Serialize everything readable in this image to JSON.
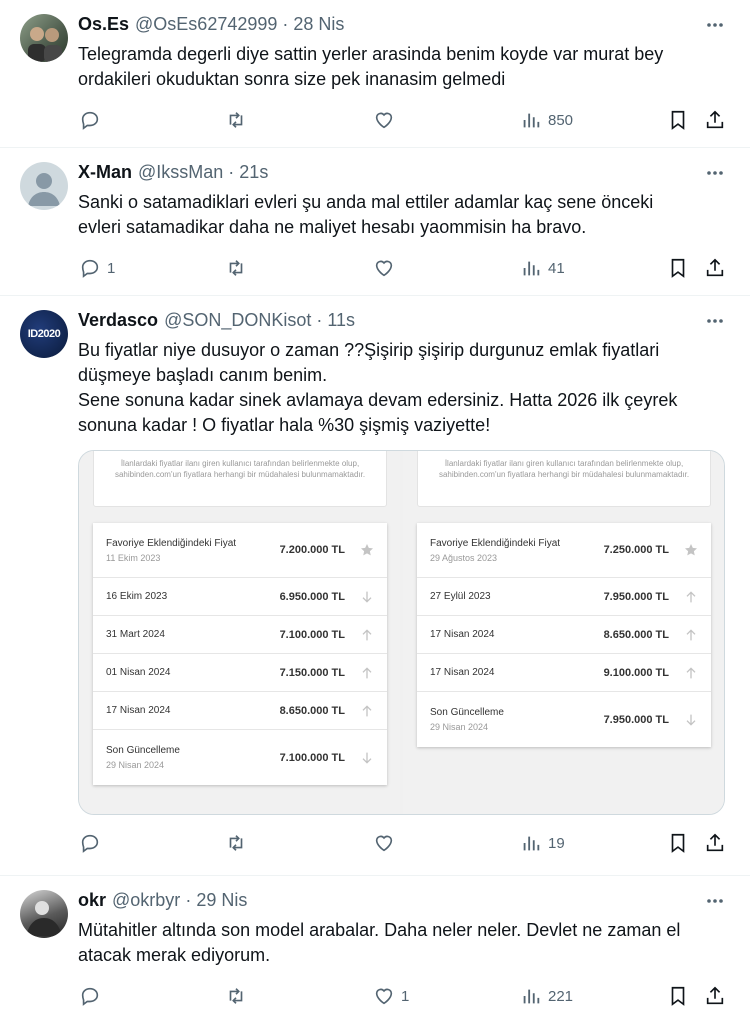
{
  "tweets": [
    {
      "name": "Os.Es",
      "handle": "@OsEs62742999",
      "time": "28 Nis",
      "text": "Telegramda degerli diye sattin yerler arasinda benim koyde var murat bey\nordakileri okuduktan sonra size pek inanasim gelmedi",
      "replies": "",
      "likes": "",
      "views": "850",
      "avatar_color": "#6b7d6a"
    },
    {
      "name": "X-Man",
      "handle": "@IkssMan",
      "time": "21s",
      "text": "Sanki o satamadiklari evleri şu anda mal ettiler adamlar kaç sene önceki\nevleri satamadikar daha ne maliyet hesabı yaommisin ha bravo.",
      "replies": "1",
      "likes": "",
      "views": "41",
      "avatar_color": "#cfd9de"
    },
    {
      "name": "Verdasco",
      "handle": "@SON_DONKisot",
      "time": "11s",
      "text": "Bu fiyatlar niye dusuyor o zaman ??Şişirip şişirip durgunuz emlak fiyatlari\ndüşmeye başladı canım benim.\nSene sonuna kadar sinek avlamaya devam edersiniz. Hatta 2026 ilk çeyrek\nsonuna kadar ! O fiyatlar hala %30 şişmiş vaziyette!",
      "replies": "",
      "likes": "",
      "views": "19",
      "avatar_color": "#0a1a3a",
      "avatar_text": "ID2020"
    },
    {
      "name": "okr",
      "handle": "@okrbyr",
      "time": "29 Nis",
      "text": "Mütahitler altında son model arabalar. Daha neler neler. Devlet ne zaman el\natacak merak ediyorum.",
      "replies": "",
      "likes": "1",
      "views": "221",
      "avatar_color": "#3a3a3a"
    }
  ],
  "media": {
    "notice": "İlanlardaki fiyatlar ilanı giren kullanıcı tarafından belirlenmekte olup, sahibinden.com'un fiyatlara herhangi bir müdahalesi bulunmamaktadır.",
    "left": [
      {
        "label": "Favoriye Eklendiğindeki Fiyat",
        "sub": "11 Ekim 2023",
        "price": "7.200.000 TL",
        "icon": "star"
      },
      {
        "label": "16 Ekim 2023",
        "sub": "",
        "price": "6.950.000 TL",
        "icon": "down"
      },
      {
        "label": "31 Mart 2024",
        "sub": "",
        "price": "7.100.000 TL",
        "icon": "up"
      },
      {
        "label": "01 Nisan 2024",
        "sub": "",
        "price": "7.150.000 TL",
        "icon": "up"
      },
      {
        "label": "17 Nisan 2024",
        "sub": "",
        "price": "8.650.000 TL",
        "icon": "up"
      },
      {
        "label": "Son Güncelleme",
        "sub": "29 Nisan 2024",
        "price": "7.100.000 TL",
        "icon": "down"
      }
    ],
    "right": [
      {
        "label": "Favoriye Eklendiğindeki Fiyat",
        "sub": "29 Ağustos 2023",
        "price": "7.250.000 TL",
        "icon": "star"
      },
      {
        "label": "27 Eylül 2023",
        "sub": "",
        "price": "7.950.000 TL",
        "icon": "up"
      },
      {
        "label": "17 Nisan 2024",
        "sub": "",
        "price": "8.650.000 TL",
        "icon": "up"
      },
      {
        "label": "17 Nisan 2024",
        "sub": "",
        "price": "9.100.000 TL",
        "icon": "up"
      },
      {
        "label": "Son Güncelleme",
        "sub": "29 Nisan 2024",
        "price": "7.950.000 TL",
        "icon": "down"
      }
    ]
  },
  "icons": {
    "reply": "reply-icon",
    "retweet": "retweet-icon",
    "like": "heart-icon",
    "views": "views-icon",
    "bookmark": "bookmark-icon",
    "share": "share-icon",
    "more": "more-icon"
  }
}
